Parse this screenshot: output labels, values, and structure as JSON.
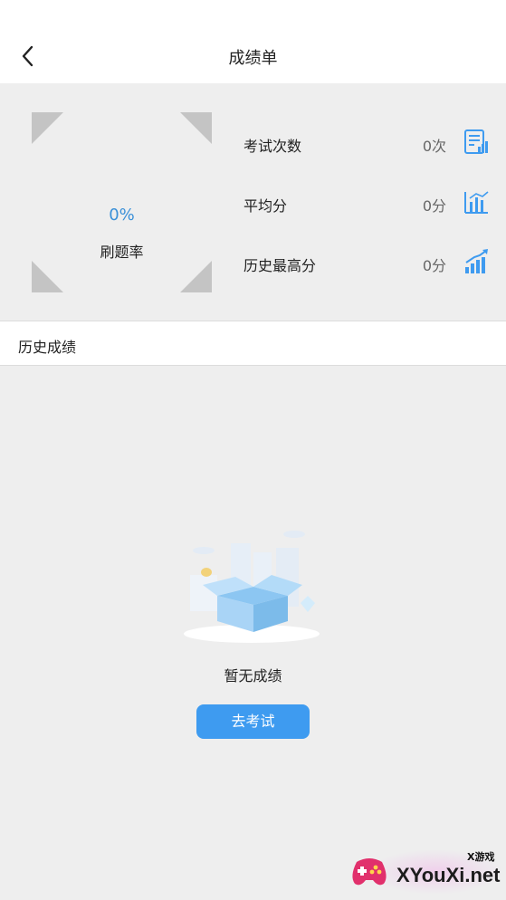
{
  "header": {
    "title": "成绩单",
    "back_icon": "back-arrow-icon"
  },
  "stats": {
    "rate_percent": "0%",
    "rate_value": 0,
    "rate_label": "刷题率",
    "rows": [
      {
        "label": "考试次数",
        "value": "0次",
        "icon": "exam-document-icon"
      },
      {
        "label": "平均分",
        "value": "0分",
        "icon": "bar-chart-icon"
      },
      {
        "label": "历史最高分",
        "value": "0分",
        "icon": "rising-chart-icon"
      }
    ]
  },
  "history": {
    "title": "历史成绩"
  },
  "empty_state": {
    "text": "暂无成绩",
    "button_label": "去考试",
    "illustration": "empty-box-illustration"
  },
  "watermark": {
    "sub": "X游戏",
    "main": "XYouXi.net"
  },
  "colors": {
    "accent": "#3e9bf0",
    "percent_text": "#3a90d8",
    "background": "#eeeeee",
    "ring_gray": "#c4c4c4"
  }
}
